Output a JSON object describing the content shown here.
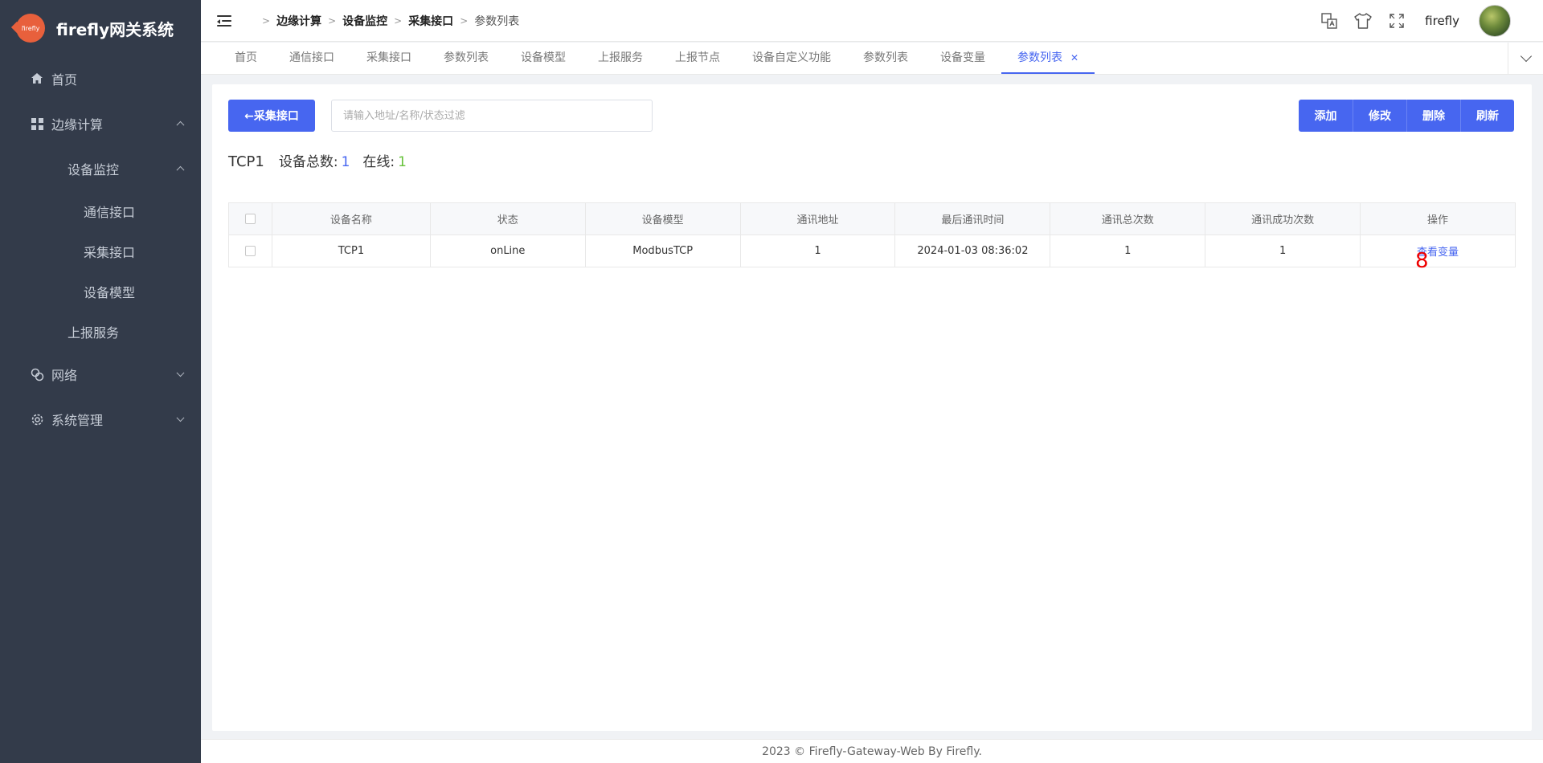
{
  "app": {
    "title": "firefly网关系统",
    "logo_text": "firefly"
  },
  "sidebar": {
    "items": [
      {
        "label": "首页"
      },
      {
        "label": "边缘计算"
      },
      {
        "label": "设备监控"
      },
      {
        "label": "通信接口"
      },
      {
        "label": "采集接口"
      },
      {
        "label": "设备模型"
      },
      {
        "label": "上报服务"
      },
      {
        "label": "网络"
      },
      {
        "label": "系统管理"
      }
    ]
  },
  "breadcrumb": [
    "边缘计算",
    "设备监控",
    "采集接口",
    "参数列表"
  ],
  "user": {
    "name": "firefly"
  },
  "tabs": [
    {
      "label": "首页"
    },
    {
      "label": "通信接口"
    },
    {
      "label": "采集接口"
    },
    {
      "label": "参数列表"
    },
    {
      "label": "设备模型"
    },
    {
      "label": "上报服务"
    },
    {
      "label": "上报节点"
    },
    {
      "label": "设备自定义功能"
    },
    {
      "label": "参数列表"
    },
    {
      "label": "设备变量"
    },
    {
      "label": "参数列表"
    }
  ],
  "toolbar": {
    "back_label": "←采集接口",
    "search_placeholder": "请输入地址/名称/状态过滤",
    "search_value": "",
    "add_label": "添加",
    "edit_label": "修改",
    "delete_label": "删除",
    "refresh_label": "刷新"
  },
  "summary": {
    "port": "TCP1",
    "total_label": "设备总数:",
    "total": "1",
    "online_label": "在线:",
    "online": "1"
  },
  "table": {
    "headers": [
      "设备名称",
      "状态",
      "设备模型",
      "通讯地址",
      "最后通讯时间",
      "通讯总次数",
      "通讯成功次数",
      "操作"
    ],
    "rows": [
      {
        "name": "TCP1",
        "status": "onLine",
        "model": "ModbusTCP",
        "address": "1",
        "last_time": "2024-01-03 08:36:02",
        "total": "1",
        "success": "1",
        "action": "查看变量"
      }
    ]
  },
  "annotation": {
    "text": "8",
    "color": "#ee0000"
  },
  "footer": {
    "text": "2023 © Firefly-Gateway-Web By Firefly."
  },
  "colors": {
    "accent": "#4766f0",
    "sidebar_bg": "#333b4a",
    "online": "#67c23a"
  }
}
